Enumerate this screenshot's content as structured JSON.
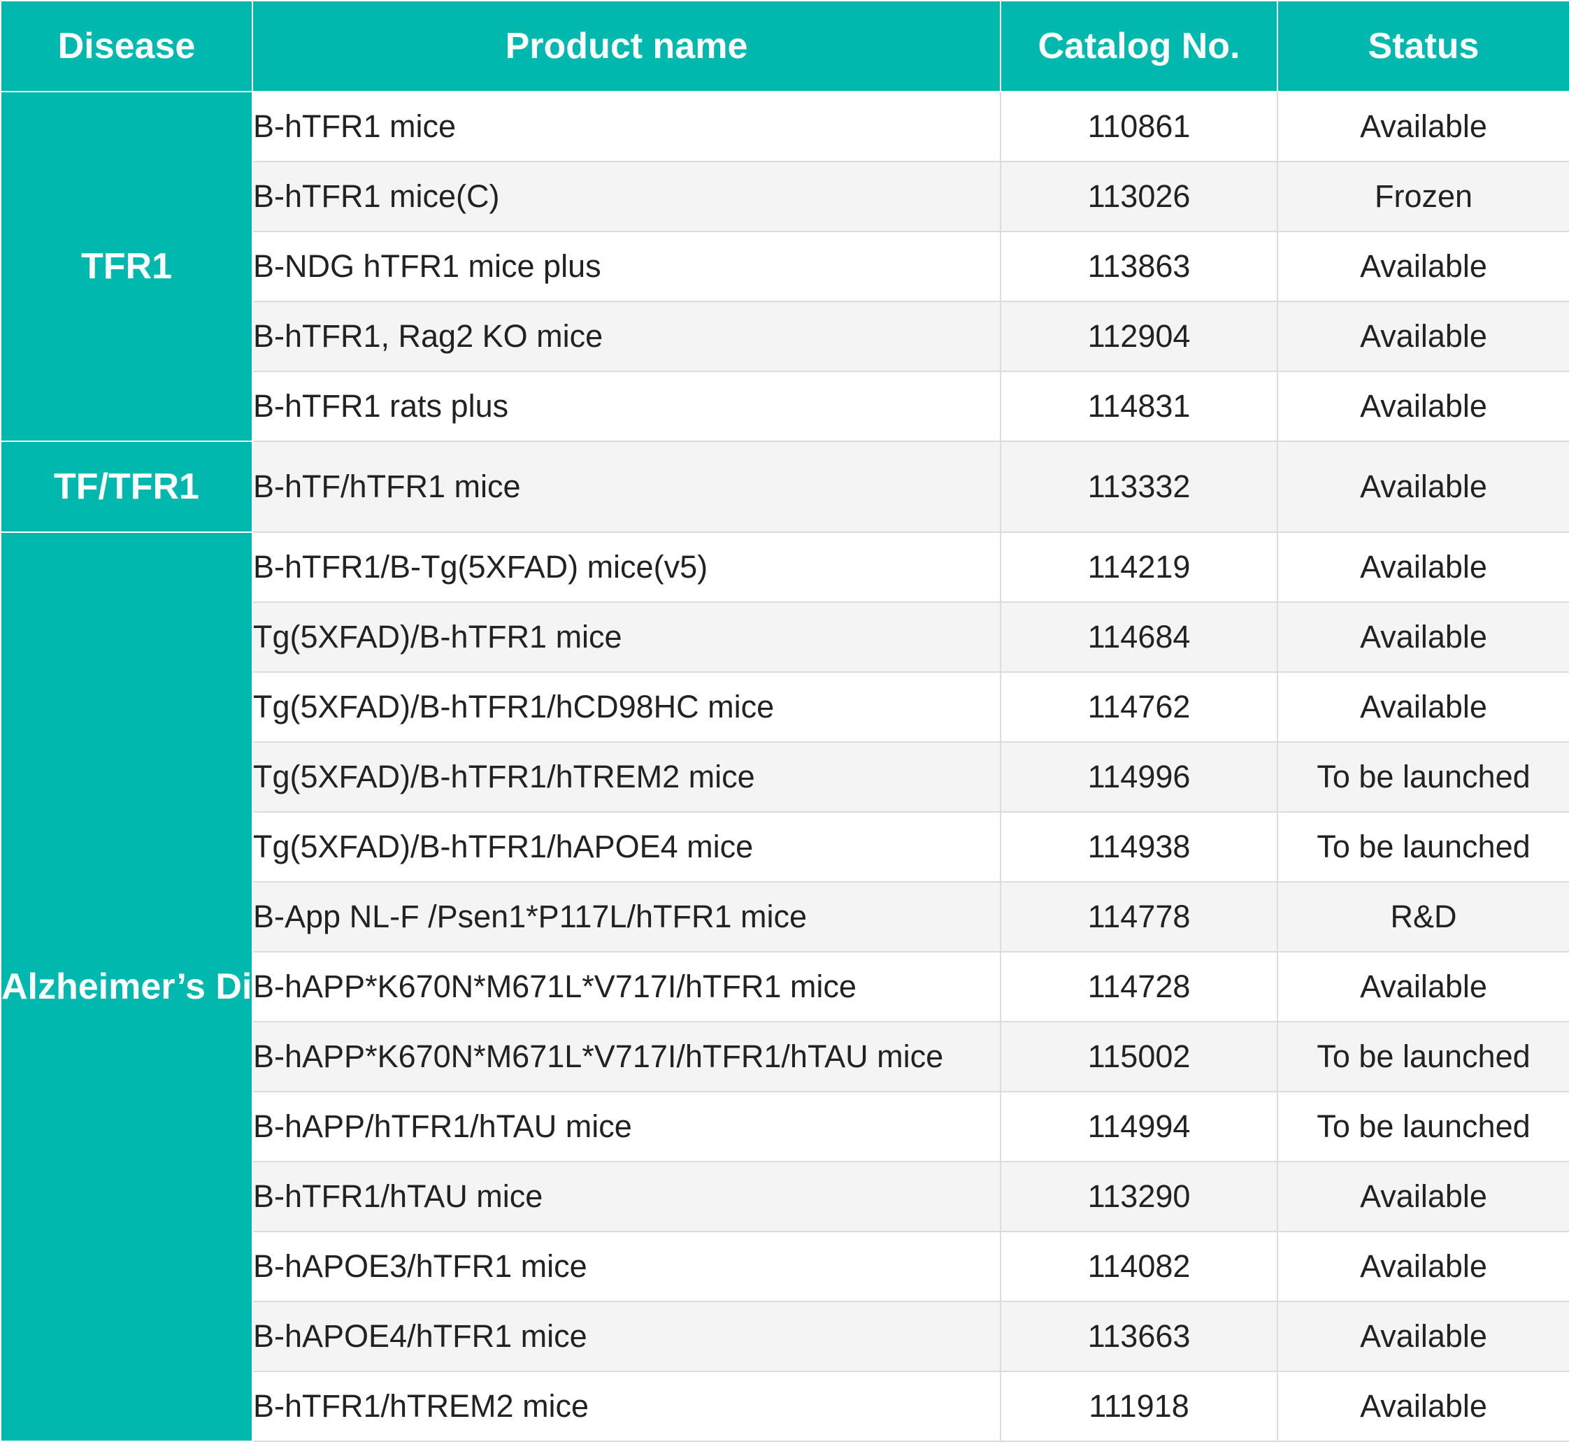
{
  "colors": {
    "accent": "#00b8ad",
    "row_alt": "#f4f4f4",
    "text": "#222222",
    "header_text": "#ffffff"
  },
  "header": {
    "disease": "Disease",
    "product_name": "Product name",
    "catalog_no": "Catalog No.",
    "status": "Status"
  },
  "groups": [
    {
      "disease": "TFR1",
      "rows": [
        {
          "product": "B-hTFR1 mice",
          "catalog": "110861",
          "status": "Available"
        },
        {
          "product": "B-hTFR1 mice(C)",
          "catalog": "113026",
          "status": "Frozen"
        },
        {
          "product": "B-NDG hTFR1 mice plus",
          "catalog": "113863",
          "status": "Available"
        },
        {
          "product": "B-hTFR1, Rag2 KO mice",
          "catalog": "112904",
          "status": "Available"
        },
        {
          "product": "B-hTFR1 rats plus",
          "catalog": "114831",
          "status": "Available"
        }
      ]
    },
    {
      "disease": "TF/TFR1",
      "rows": [
        {
          "product": "B-hTF/hTFR1 mice",
          "catalog": "113332",
          "status": "Available"
        }
      ]
    },
    {
      "disease": "Alzheimer’s Disease",
      "rows": [
        {
          "product": "B-hTFR1/B-Tg(5XFAD) mice(v5)",
          "catalog": "114219",
          "status": "Available"
        },
        {
          "product": "Tg(5XFAD)/B-hTFR1 mice",
          "catalog": "114684",
          "status": "Available"
        },
        {
          "product": "Tg(5XFAD)/B-hTFR1/hCD98HC mice",
          "catalog": "114762",
          "status": "Available"
        },
        {
          "product": "Tg(5XFAD)/B-hTFR1/hTREM2 mice",
          "catalog": "114996",
          "status": "To be launched"
        },
        {
          "product": "Tg(5XFAD)/B-hTFR1/hAPOE4 mice",
          "catalog": "114938",
          "status": "To be launched"
        },
        {
          "product": "B-App NL-F /Psen1*P117L/hTFR1 mice",
          "catalog": "114778",
          "status": "R&D"
        },
        {
          "product": "B-hAPP*K670N*M671L*V717I/hTFR1 mice",
          "catalog": "114728",
          "status": "Available"
        },
        {
          "product": "B-hAPP*K670N*M671L*V717I/hTFR1/hTAU mice",
          "catalog": "115002",
          "status": "To be launched"
        },
        {
          "product": "B-hAPP/hTFR1/hTAU mice",
          "catalog": "114994",
          "status": "To be launched"
        },
        {
          "product": "B-hTFR1/hTAU mice",
          "catalog": "113290",
          "status": "Available"
        },
        {
          "product": "B-hAPOE3/hTFR1 mice",
          "catalog": "114082",
          "status": "Available"
        },
        {
          "product": "B-hAPOE4/hTFR1 mice",
          "catalog": "113663",
          "status": "Available"
        },
        {
          "product": "B-hTFR1/hTREM2 mice",
          "catalog": "111918",
          "status": "Available"
        }
      ]
    }
  ]
}
